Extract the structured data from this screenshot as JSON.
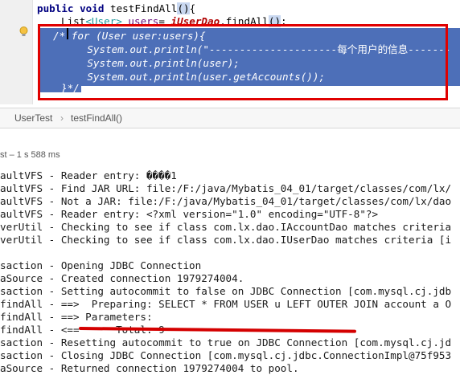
{
  "editor": {
    "lines": [
      {
        "kw": "public",
        "rest1": " ",
        "kw2": "void",
        "rest2": " testFindAll",
        "paren": "()",
        "rest3": "{"
      },
      {
        "type": "List",
        "generic": "<User>",
        "var": " users",
        "rest": "= ",
        "call": "iUserDao",
        "rest2": ".findAll",
        "paren": "()",
        "end": ";"
      }
    ],
    "selected_lines": [
      {
        "prefix": "/*",
        "code": " for (User user:users){"
      },
      {
        "code": "    System.out.println(\"---------------------",
        "cjk": "每个用户的信息",
        "tail": "-------"
      },
      {
        "code": "    System.out.println(user);"
      },
      {
        "code": "    System.out.println(user.getAccounts());"
      },
      {
        "code": "}*/"
      }
    ]
  },
  "breadcrumb": {
    "items": [
      "UserTest",
      "testFindAll()"
    ],
    "separator": "›"
  },
  "run": {
    "status": "st – 1 s 588 ms"
  },
  "console": {
    "rows": [
      {
        "src": "aultVFS",
        "msg": " - Reader entry: ����1"
      },
      {
        "src": "aultVFS",
        "msg": " - Find JAR URL: file:/F:/java/Mybatis_04_01/target/classes/com/lx/"
      },
      {
        "src": "aultVFS",
        "msg": " - Not a JAR: file:/F:/java/Mybatis_04_01/target/classes/com/lx/dao"
      },
      {
        "src": "aultVFS",
        "msg": " - Reader entry: <?xml version=\"1.0\" encoding=\"UTF-8\"?>"
      },
      {
        "src": "verUtil",
        "msg": " - Checking to see if class com.lx.dao.IAccountDao matches criteria"
      },
      {
        "src": "verUtil",
        "msg": " - Checking to see if class com.lx.dao.IUserDao matches criteria [i"
      },
      {
        "src": "",
        "msg": ""
      },
      {
        "src": "saction",
        "msg": " - Opening JDBC Connection"
      },
      {
        "src": "aSource",
        "msg": " - Created connection 1979274004."
      },
      {
        "src": "saction",
        "msg": " - Setting autocommit to false on JDBC Connection [com.mysql.cj.jdb"
      },
      {
        "src": "findAll",
        "msg": " - ==>  Preparing: SELECT * FROM USER u LEFT OUTER JOIN account a O"
      },
      {
        "src": "findAll",
        "msg": " - ==> Parameters: "
      },
      {
        "src": "findAll",
        "msg": " - <==      Total: 9"
      },
      {
        "src": "saction",
        "msg": " - Resetting autocommit to true on JDBC Connection [com.mysql.cj.jd"
      },
      {
        "src": "saction",
        "msg": " - Closing JDBC Connection [com.mysql.cj.jdbc.ConnectionImpl@75f953"
      },
      {
        "src": "aSource",
        "msg": " - Returned connection 1979274004 to pool."
      }
    ]
  },
  "colors": {
    "selection": "#4d6fb8",
    "annotation_red": "#e00000"
  }
}
